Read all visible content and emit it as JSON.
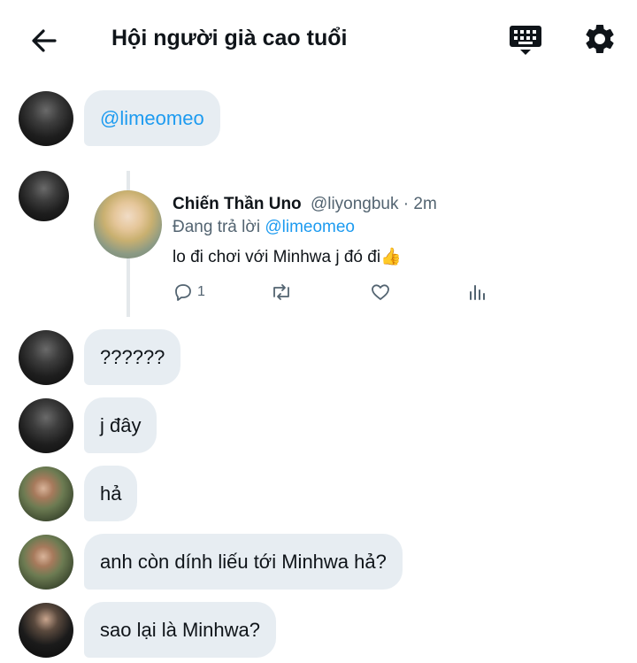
{
  "header": {
    "title": "Hội người già cao tuổi",
    "back_icon": "arrow-left-icon",
    "keyboard_icon": "keyboard-hide-icon",
    "settings_icon": "gear-icon"
  },
  "messages": [
    {
      "text": "@limeomeo"
    },
    {
      "text": "??????"
    },
    {
      "text": "j đây"
    },
    {
      "text": "hả"
    },
    {
      "text": "anh còn dính liếu tới Minhwa hả?"
    },
    {
      "text": "sao lại là Minhwa?"
    }
  ],
  "quoted_tweet": {
    "name": "Chiến Thần Uno",
    "handle": "@liyongbuk",
    "sep": " · ",
    "time": "2m",
    "reply_prefix": "Đang trả lời ",
    "reply_to": "@limeomeo",
    "text": "lo đi chơi với Minhwa j đó đi",
    "emoji": "👍",
    "reply_count": "1"
  },
  "colors": {
    "accent": "#1d9bf0",
    "bubble": "#e7edf2",
    "text": "#0f1419",
    "secondary_text": "#536471"
  }
}
